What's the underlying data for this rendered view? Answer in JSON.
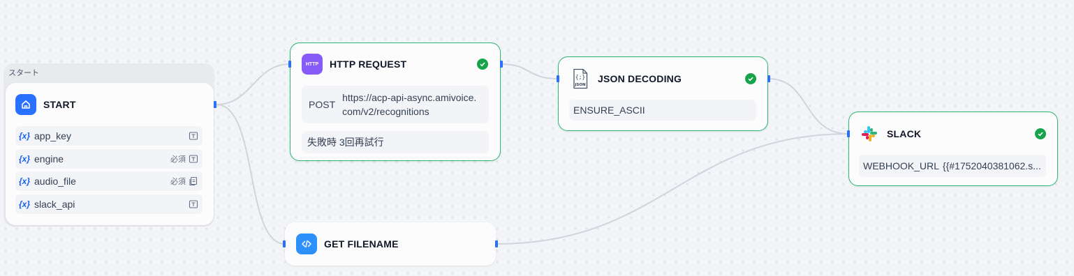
{
  "edges_color": "#d0d5dd",
  "start_group": {
    "label": "スタート",
    "title": "START",
    "variables": [
      {
        "symbol": "{x}",
        "name": "app_key",
        "required": "",
        "type_icon": "text-type-icon"
      },
      {
        "symbol": "{x}",
        "name": "engine",
        "required": "必須",
        "type_icon": "text-type-icon"
      },
      {
        "symbol": "{x}",
        "name": "audio_file",
        "required": "必須",
        "type_icon": "file-type-icon"
      },
      {
        "symbol": "{x}",
        "name": "slack_api",
        "required": "",
        "type_icon": "text-type-icon"
      }
    ]
  },
  "http_node": {
    "icon_text": "HTTP",
    "title": "HTTP REQUEST",
    "method": "POST",
    "url": "https://acp-api-async.amivoice.com/v2/recognitions",
    "url_line1": "https://acp-api-async.amivoice.",
    "url_line2": "com/v2/recognitions",
    "retry": "失敗時 3回再試行",
    "status": "success"
  },
  "json_node": {
    "icon_text": "JSON",
    "title": "JSON DECODING",
    "option": "ENSURE_ASCII",
    "status": "success"
  },
  "slack_node": {
    "title": "SLACK",
    "param_key": "WEBHOOK_URL",
    "param_value": "{{#1752040381062.s...",
    "status": "success"
  },
  "code_node": {
    "title": "GET FILENAME"
  }
}
